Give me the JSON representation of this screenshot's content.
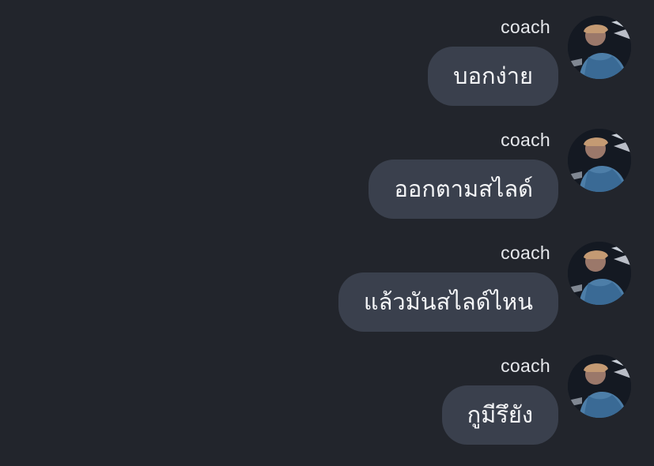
{
  "messages": [
    {
      "sender": "coach",
      "text": "บอกง่าย",
      "avatar_icon": "user-avatar-icon"
    },
    {
      "sender": "coach",
      "text": "ออกตามสไลด์",
      "avatar_icon": "user-avatar-icon"
    },
    {
      "sender": "coach",
      "text": "แล้วมันสไลด์ไหน",
      "avatar_icon": "user-avatar-icon"
    },
    {
      "sender": "coach",
      "text": "กูมีรึยัง",
      "avatar_icon": "user-avatar-icon"
    }
  ],
  "colors": {
    "background": "#22252c",
    "bubble": "#3a404d",
    "text": "#f4f5f7",
    "sender": "#e6e8ec"
  }
}
